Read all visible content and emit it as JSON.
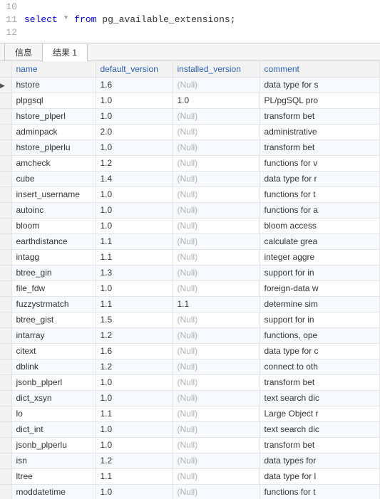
{
  "editor": {
    "lines": [
      {
        "num": "10",
        "html": ""
      },
      {
        "num": "11",
        "html": "<span class='kw'>select</span> <span class='op'>*</span> <span class='kw'>from</span> <span class='ident'>pg_available_extensions;</span>"
      },
      {
        "num": "12",
        "html": ""
      }
    ]
  },
  "tabs": {
    "info_label": "信息",
    "results_label": "结果 1",
    "active": 1
  },
  "table": {
    "columns": [
      "name",
      "default_version",
      "installed_version",
      "comment"
    ],
    "null_text": "(Null)",
    "rows": [
      {
        "selected": true,
        "name": "hstore",
        "default_version": "1.6",
        "installed_version": null,
        "comment": "data type for s"
      },
      {
        "selected": false,
        "name": "plpgsql",
        "default_version": "1.0",
        "installed_version": "1.0",
        "comment": "PL/pgSQL pro"
      },
      {
        "selected": false,
        "name": "hstore_plperl",
        "default_version": "1.0",
        "installed_version": null,
        "comment": "transform bet"
      },
      {
        "selected": false,
        "name": "adminpack",
        "default_version": "2.0",
        "installed_version": null,
        "comment": "administrative"
      },
      {
        "selected": false,
        "name": "hstore_plperlu",
        "default_version": "1.0",
        "installed_version": null,
        "comment": "transform bet"
      },
      {
        "selected": false,
        "name": "amcheck",
        "default_version": "1.2",
        "installed_version": null,
        "comment": "functions for v"
      },
      {
        "selected": false,
        "name": "cube",
        "default_version": "1.4",
        "installed_version": null,
        "comment": "data type for r"
      },
      {
        "selected": false,
        "name": "insert_username",
        "default_version": "1.0",
        "installed_version": null,
        "comment": "functions for t"
      },
      {
        "selected": false,
        "name": "autoinc",
        "default_version": "1.0",
        "installed_version": null,
        "comment": "functions for a"
      },
      {
        "selected": false,
        "name": "bloom",
        "default_version": "1.0",
        "installed_version": null,
        "comment": "bloom access"
      },
      {
        "selected": false,
        "name": "earthdistance",
        "default_version": "1.1",
        "installed_version": null,
        "comment": "calculate grea"
      },
      {
        "selected": false,
        "name": "intagg",
        "default_version": "1.1",
        "installed_version": null,
        "comment": "integer aggre"
      },
      {
        "selected": false,
        "name": "btree_gin",
        "default_version": "1.3",
        "installed_version": null,
        "comment": "support for in"
      },
      {
        "selected": false,
        "name": "file_fdw",
        "default_version": "1.0",
        "installed_version": null,
        "comment": "foreign-data w"
      },
      {
        "selected": false,
        "name": "fuzzystrmatch",
        "default_version": "1.1",
        "installed_version": "1.1",
        "comment": "determine sim"
      },
      {
        "selected": false,
        "name": "btree_gist",
        "default_version": "1.5",
        "installed_version": null,
        "comment": "support for in"
      },
      {
        "selected": false,
        "name": "intarray",
        "default_version": "1.2",
        "installed_version": null,
        "comment": "functions, ope"
      },
      {
        "selected": false,
        "name": "citext",
        "default_version": "1.6",
        "installed_version": null,
        "comment": "data type for c"
      },
      {
        "selected": false,
        "name": "dblink",
        "default_version": "1.2",
        "installed_version": null,
        "comment": "connect to oth"
      },
      {
        "selected": false,
        "name": "jsonb_plperl",
        "default_version": "1.0",
        "installed_version": null,
        "comment": "transform bet"
      },
      {
        "selected": false,
        "name": "dict_xsyn",
        "default_version": "1.0",
        "installed_version": null,
        "comment": "text search dic"
      },
      {
        "selected": false,
        "name": "lo",
        "default_version": "1.1",
        "installed_version": null,
        "comment": "Large Object r"
      },
      {
        "selected": false,
        "name": "dict_int",
        "default_version": "1.0",
        "installed_version": null,
        "comment": "text search dic"
      },
      {
        "selected": false,
        "name": "jsonb_plperlu",
        "default_version": "1.0",
        "installed_version": null,
        "comment": "transform bet"
      },
      {
        "selected": false,
        "name": "isn",
        "default_version": "1.2",
        "installed_version": null,
        "comment": "data types for"
      },
      {
        "selected": false,
        "name": "ltree",
        "default_version": "1.1",
        "installed_version": null,
        "comment": "data type for l"
      },
      {
        "selected": false,
        "name": "moddatetime",
        "default_version": "1.0",
        "installed_version": null,
        "comment": "functions for t"
      }
    ]
  }
}
